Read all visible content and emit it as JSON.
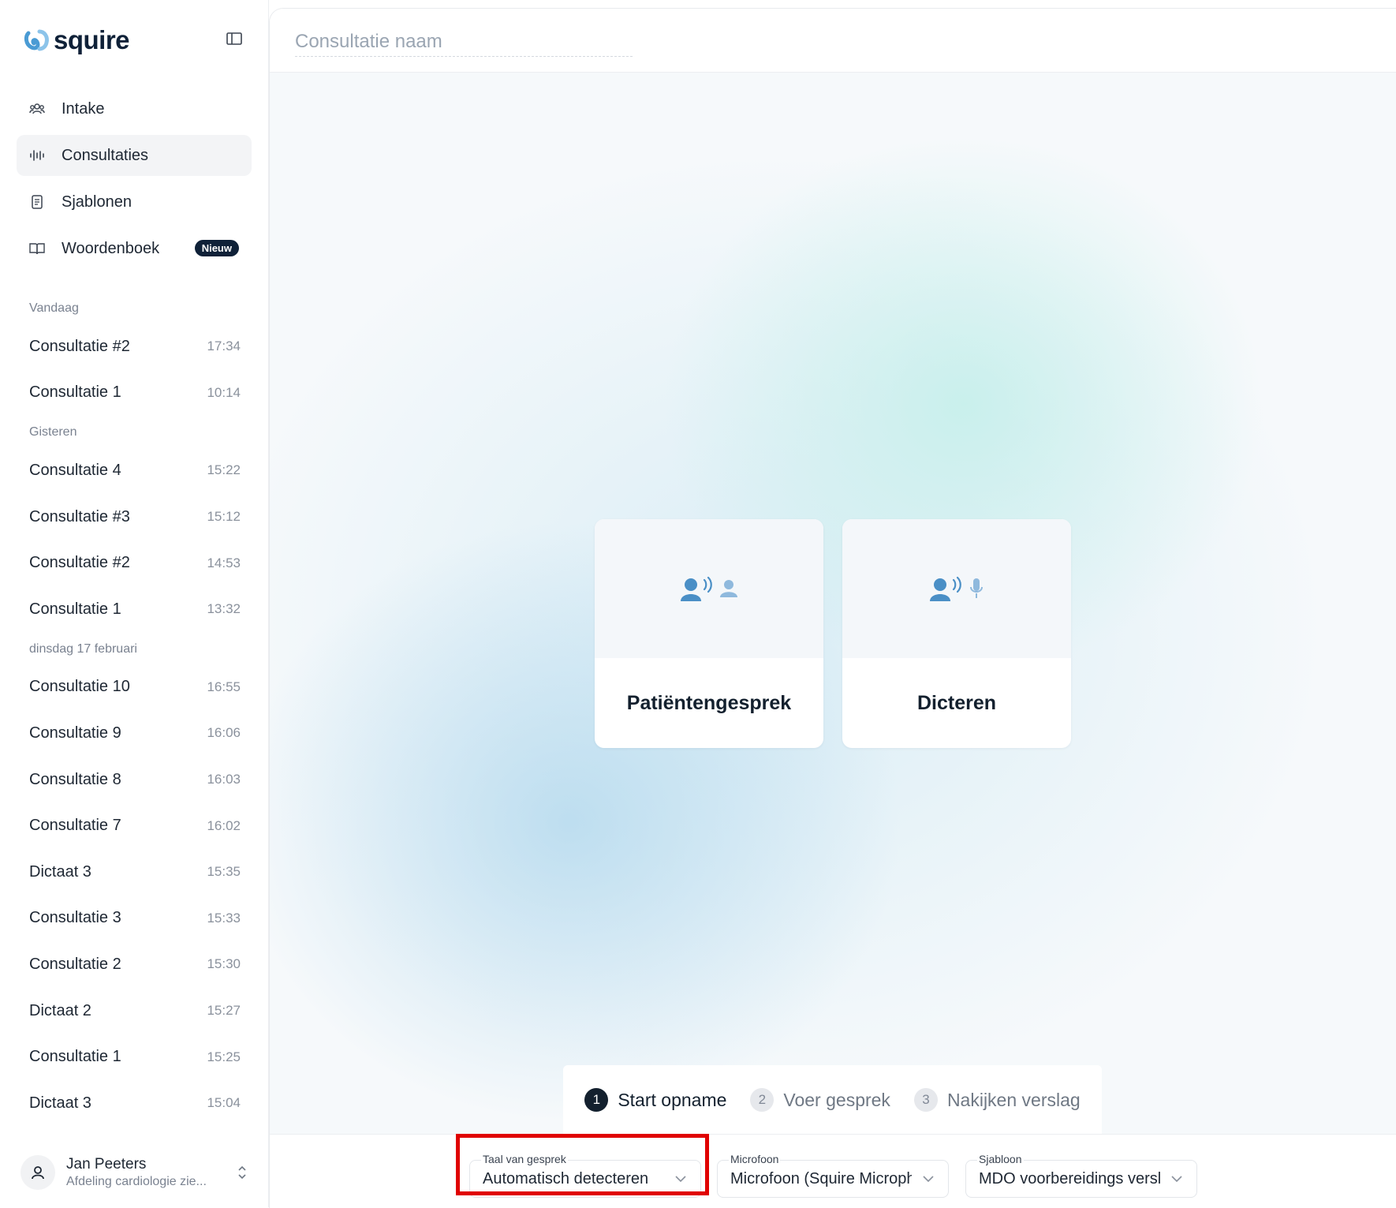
{
  "brand": {
    "name": "squire",
    "accent": "#4a9bd4"
  },
  "nav": [
    {
      "label": "Intake",
      "icon": "users-icon"
    },
    {
      "label": "Consultaties",
      "icon": "waveform-icon",
      "active": true
    },
    {
      "label": "Sjablonen",
      "icon": "document-icon"
    },
    {
      "label": "Woordenboek",
      "icon": "book-icon",
      "badge": "Nieuw"
    }
  ],
  "history": {
    "today": {
      "label": "Vandaag",
      "items": [
        {
          "title": "Consultatie #2",
          "time": "17:34"
        },
        {
          "title": "Consultatie 1",
          "time": "10:14"
        }
      ]
    },
    "yesterday": {
      "label": "Gisteren",
      "items": [
        {
          "title": "Consultatie 4",
          "time": "15:22"
        },
        {
          "title": "Consultatie #3",
          "time": "15:12"
        },
        {
          "title": "Consultatie #2",
          "time": "14:53"
        },
        {
          "title": "Consultatie 1",
          "time": "13:32"
        }
      ]
    },
    "feb17": {
      "label": "dinsdag 17 februari",
      "items": [
        {
          "title": "Consultatie 10",
          "time": "16:55"
        },
        {
          "title": "Consultatie 9",
          "time": "16:06"
        },
        {
          "title": "Consultatie 8",
          "time": "16:03"
        },
        {
          "title": "Consultatie 7",
          "time": "16:02"
        },
        {
          "title": "Dictaat 3",
          "time": "15:35"
        },
        {
          "title": "Consultatie 3",
          "time": "15:33"
        },
        {
          "title": "Consultatie 2",
          "time": "15:30"
        },
        {
          "title": "Dictaat 2",
          "time": "15:27"
        },
        {
          "title": "Consultatie 1",
          "time": "15:25"
        },
        {
          "title": "Dictaat 3",
          "time": "15:04"
        }
      ]
    }
  },
  "user": {
    "name": "Jan Peeters",
    "department": "Afdeling cardiologie zie..."
  },
  "main": {
    "name_placeholder": "Consultatie naam",
    "cards": [
      {
        "label": "Patiëntengesprek"
      },
      {
        "label": "Dicteren"
      }
    ],
    "steps": [
      {
        "num": "1",
        "label": "Start opname",
        "active": true
      },
      {
        "num": "2",
        "label": "Voer gesprek"
      },
      {
        "num": "3",
        "label": "Nakijken verslag"
      }
    ]
  },
  "controls": {
    "language": {
      "label": "Taal van gesprek",
      "value": "Automatisch detecteren"
    },
    "microphone": {
      "label": "Microfoon",
      "value": "Microfoon (Squire Microph"
    },
    "template": {
      "label": "Sjabloon",
      "value": "MDO voorbereidings versl"
    }
  },
  "colors": {
    "highlight": "#e00000",
    "dark": "#13202e",
    "icon_blue": "#4a8fc6"
  }
}
